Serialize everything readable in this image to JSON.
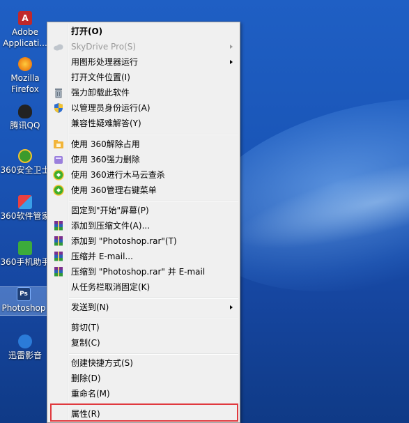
{
  "desktop": {
    "icons": [
      {
        "label": "Adobe Applicati...",
        "icon": "adobe-icon",
        "color": "#c0282c"
      },
      {
        "label": "Mozilla Firefox",
        "icon": "firefox-icon",
        "color": "#e66000"
      },
      {
        "label": "腾讯QQ",
        "icon": "qq-penguin-icon",
        "color": "#222222"
      },
      {
        "label": "360安全卫士",
        "icon": "360-safe-icon",
        "color": "#3b9a2c"
      },
      {
        "label": "360软件管家",
        "icon": "360-software-icon",
        "color": "#2b8fd6"
      },
      {
        "label": "360手机助手",
        "icon": "360-phone-icon",
        "color": "#3cab3b"
      },
      {
        "label": "Photoshop",
        "icon": "photoshop-icon",
        "color": "#1e3f77"
      },
      {
        "label": "迅雷影音",
        "icon": "xunlei-player-icon",
        "color": "#2b7bd8"
      }
    ]
  },
  "context_menu": {
    "items": [
      {
        "label": "打开(O)"
      },
      {
        "label": "SkyDrive Pro(S)"
      },
      {
        "label": "用图形处理器运行"
      },
      {
        "label": "打开文件位置(I)"
      },
      {
        "label": "强力卸载此软件"
      },
      {
        "label": "以管理员身份运行(A)"
      },
      {
        "label": "兼容性疑难解答(Y)"
      },
      {
        "label": "使用 360解除占用"
      },
      {
        "label": "使用 360强力删除"
      },
      {
        "label": "使用 360进行木马云查杀"
      },
      {
        "label": "使用 360管理右键菜单"
      },
      {
        "label": "固定到\"开始\"屏幕(P)"
      },
      {
        "label": "添加到压缩文件(A)..."
      },
      {
        "label": "添加到 \"Photoshop.rar\"(T)"
      },
      {
        "label": "压缩并 E-mail..."
      },
      {
        "label": "压缩到 \"Photoshop.rar\" 并 E-mail"
      },
      {
        "label": "从任务栏取消固定(K)"
      },
      {
        "label": "发送到(N)"
      },
      {
        "label": "剪切(T)"
      },
      {
        "label": "复制(C)"
      },
      {
        "label": "创建快捷方式(S)"
      },
      {
        "label": "删除(D)"
      },
      {
        "label": "重命名(M)"
      },
      {
        "label": "属性(R)"
      }
    ]
  },
  "colors": {
    "highlight_border": "#e0393e",
    "menu_background": "#f0f0f0",
    "desktop_background": "#1a56b8"
  }
}
